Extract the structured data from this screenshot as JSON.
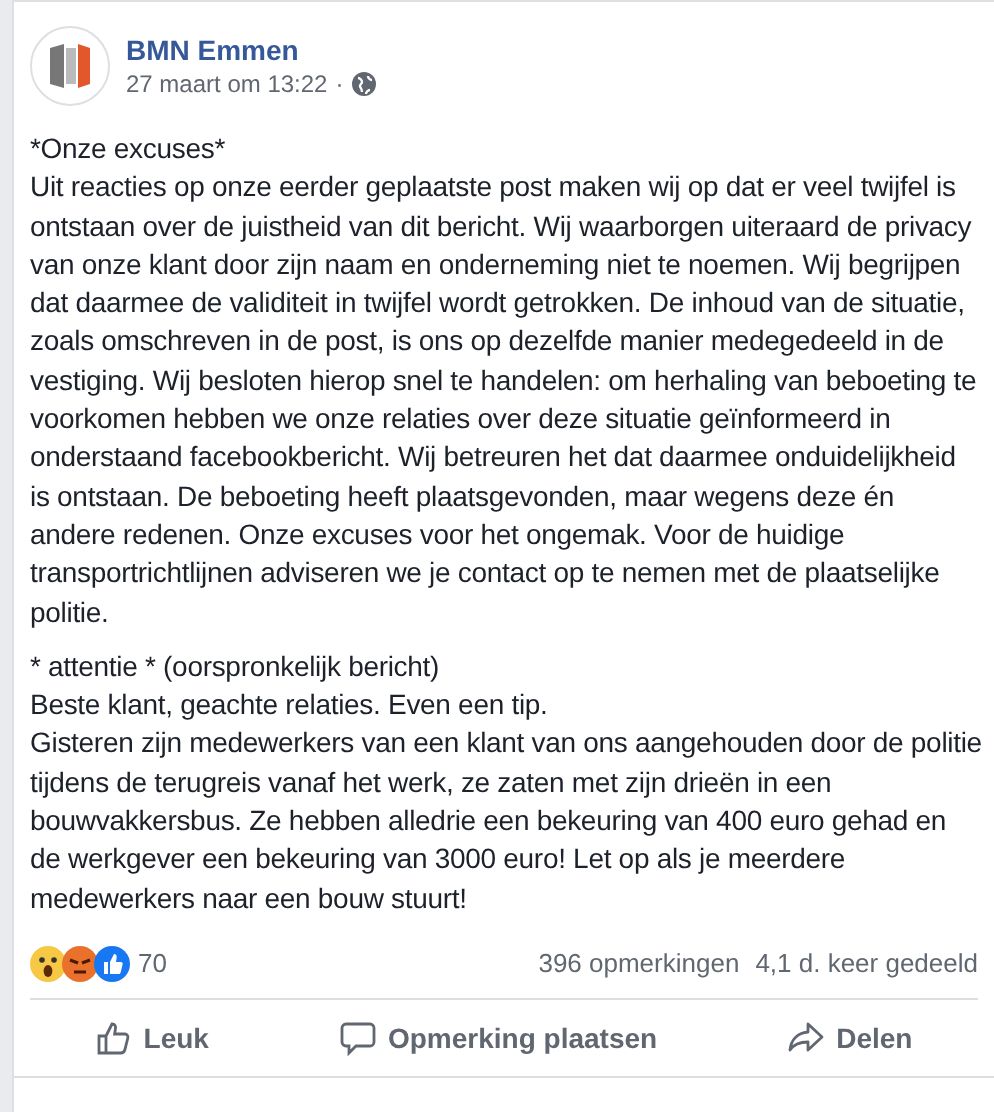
{
  "post": {
    "author": "BMN Emmen",
    "timestamp": "27 maart om 13:22",
    "separator": "·",
    "blocks": [
      [
        "*Onze excuses*",
        "Uit reacties op onze eerder geplaatste post maken wij op dat er veel twijfel is ontstaan over de juistheid van dit bericht. Wij waarborgen uiteraard de privacy van onze klant door zijn naam en onderneming niet te noemen. Wij begrijpen dat daarmee de validiteit in twijfel wordt getrokken. De inhoud van de situatie, zoals omschreven in de post, is ons op dezelfde manier medegedeeld in de vestiging. Wij besloten hierop snel te handelen: om herhaling van beboeting te voorkomen hebben we onze relaties over deze situatie geïnformeerd in onderstaand facebookbericht. Wij betreuren het dat daarmee onduidelijkheid is ontstaan. De beboeting heeft plaatsgevonden, maar wegens deze én andere redenen. Onze excuses voor het ongemak. Voor de huidige transportrichtlijnen adviseren we je contact op te nemen met de plaatselijke politie."
      ],
      [
        "* attentie * (oorspronkelijk bericht)",
        "Beste klant, geachte relaties. Even een tip.",
        "Gisteren zijn medewerkers van een klant van ons aangehouden door de politie tijdens de terugreis vanaf het werk, ze zaten met zijn drieën in een bouwvakkersbus. Ze hebben alledrie een bekeuring van 400 euro gehad en de werkgever een bekeuring van 3000 euro! Let op als je meerdere medewerkers naar een bouw stuurt!"
      ]
    ],
    "reactions": [
      {
        "kind": "wow"
      },
      {
        "kind": "angry"
      },
      {
        "kind": "like"
      }
    ],
    "reaction_count": "70",
    "comments": "396 opmerkingen",
    "shares": "4,1 d. keer gedeeld",
    "actions": [
      {
        "kind": "like",
        "label": "Leuk"
      },
      {
        "kind": "comment",
        "label": "Opmerking plaatsen"
      },
      {
        "kind": "share",
        "label": "Delen"
      }
    ]
  }
}
